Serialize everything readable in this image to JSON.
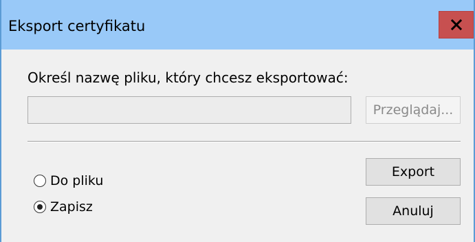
{
  "window": {
    "title": "Eksport certyfikatu",
    "close_icon": "close-icon"
  },
  "form": {
    "prompt": "Określ nazwę pliku, który chcesz eksportować:",
    "filename_value": "",
    "filename_placeholder": "",
    "browse_label": "Przeglądaj..."
  },
  "options": {
    "to_file_label": "Do pliku",
    "save_label": "Zapisz",
    "selected": "save"
  },
  "actions": {
    "export_label": "Export",
    "cancel_label": "Anuluj"
  },
  "colors": {
    "titlebar": "#99c9f8",
    "close_button": "#c75050",
    "window_border": "#5b9bd5"
  }
}
